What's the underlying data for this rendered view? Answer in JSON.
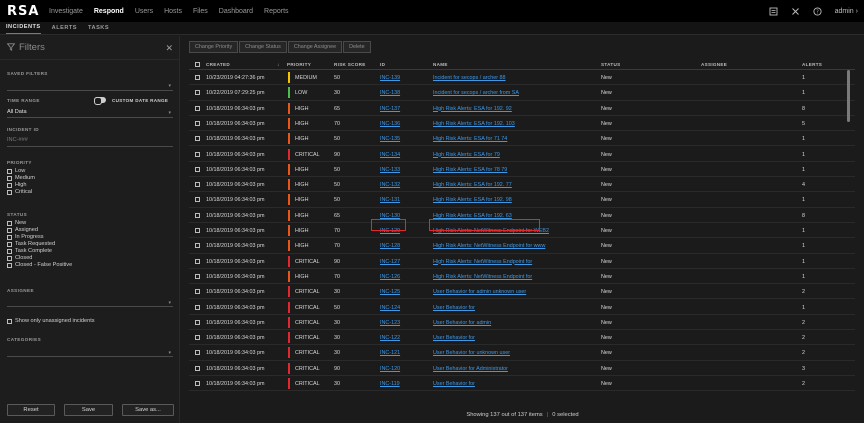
{
  "app": {
    "logo": "RSA",
    "nav": [
      "Investigate",
      "Respond",
      "Users",
      "Hosts",
      "Files",
      "Dashboard",
      "Reports"
    ],
    "active_nav": "Respond",
    "user": "admin",
    "icons": [
      "notes-icon",
      "tools-icon",
      "help-icon"
    ]
  },
  "subnav": {
    "tabs": [
      "INCIDENTS",
      "ALERTS",
      "TASKS"
    ],
    "active": "INCIDENTS"
  },
  "filters": {
    "title": "Filters",
    "saved_filters_label": "SAVED FILTERS",
    "time_range_label": "TIME RANGE",
    "custom_date_range_label": "CUSTOM DATE RANGE",
    "time_range_value": "All Data",
    "incident_id_label": "INCIDENT ID",
    "incident_id_placeholder": "INC-###",
    "priority_label": "PRIORITY",
    "priority_options": [
      "Low",
      "Medium",
      "High",
      "Critical"
    ],
    "status_label": "STATUS",
    "status_options": [
      "New",
      "Assigned",
      "In Progress",
      "Task Requested",
      "Task Complete",
      "Closed",
      "Closed - False Positive"
    ],
    "assignee_label": "ASSIGNEE",
    "unassigned_label": "Show only unassigned incidents",
    "categories_label": "CATEGORIES",
    "buttons": {
      "reset": "Reset",
      "save": "Save",
      "save_as": "Save as..."
    }
  },
  "toolbar": {
    "buttons": [
      "Change Priority",
      "Change Status",
      "Change Assignee",
      "Delete"
    ]
  },
  "table": {
    "headers": {
      "created": "CREATED",
      "priority": "PRIORITY",
      "risk_score": "RISK SCORE",
      "id": "ID",
      "name": "NAME",
      "status": "STATUS",
      "assignee": "ASSIGNEE",
      "alerts": "ALERTS"
    },
    "rows": [
      {
        "created": "10/23/2019 04:27:36 pm",
        "priority": "MEDIUM",
        "risk": "50",
        "id": "INC-139",
        "name": "Incident for secops / archer 88",
        "status": "New",
        "alerts": "1"
      },
      {
        "created": "10/22/2019 07:29:25 pm",
        "priority": "LOW",
        "risk": "30",
        "id": "INC-138",
        "name": "Incident for secops / archer from SA",
        "status": "New",
        "alerts": "1"
      },
      {
        "created": "10/18/2019 06:34:03 pm",
        "priority": "HIGH",
        "risk": "65",
        "id": "INC-137",
        "name": "High Risk Alerts: ESA for 192. 92",
        "status": "New",
        "alerts": "8"
      },
      {
        "created": "10/18/2019 06:34:03 pm",
        "priority": "HIGH",
        "risk": "70",
        "id": "INC-136",
        "name": "High Risk Alerts: ESA for 192. 103",
        "status": "New",
        "alerts": "5"
      },
      {
        "created": "10/18/2019 06:34:03 pm",
        "priority": "HIGH",
        "risk": "50",
        "id": "INC-135",
        "name": "High Risk Alerts: ESA for 71 74",
        "status": "New",
        "alerts": "1"
      },
      {
        "created": "10/18/2019 06:34:03 pm",
        "priority": "CRITICAL",
        "risk": "90",
        "id": "INC-134",
        "name": "High Risk Alerts: ESA for 79",
        "status": "New",
        "alerts": "1"
      },
      {
        "created": "10/18/2019 06:34:03 pm",
        "priority": "HIGH",
        "risk": "50",
        "id": "INC-133",
        "name": "High Risk Alerts: ESA for 78 79",
        "status": "New",
        "alerts": "1"
      },
      {
        "created": "10/18/2019 06:34:03 pm",
        "priority": "HIGH",
        "risk": "50",
        "id": "INC-132",
        "name": "High Risk Alerts: ESA for 192. 77",
        "status": "New",
        "alerts": "4"
      },
      {
        "created": "10/18/2019 06:34:03 pm",
        "priority": "HIGH",
        "risk": "50",
        "id": "INC-131",
        "name": "High Risk Alerts: ESA for 192. 98",
        "status": "New",
        "alerts": "1"
      },
      {
        "created": "10/18/2019 06:34:03 pm",
        "priority": "HIGH",
        "risk": "65",
        "id": "INC-130",
        "name": "High Risk Alerts: ESA for 192. 63",
        "status": "New",
        "alerts": "8"
      },
      {
        "created": "10/18/2019 06:34:03 pm",
        "priority": "HIGH",
        "risk": "70",
        "id": "INC-129",
        "name": "High Risk Alerts: NetWitness Endpoint for WEB2",
        "status": "New",
        "alerts": "1"
      },
      {
        "created": "10/18/2019 06:34:03 pm",
        "priority": "HIGH",
        "risk": "70",
        "id": "INC-128",
        "name": "High Risk Alerts: NetWitness Endpoint for www",
        "status": "New",
        "alerts": "1"
      },
      {
        "created": "10/18/2019 06:34:03 pm",
        "priority": "CRITICAL",
        "risk": "90",
        "id": "INC-127",
        "name": "High Risk Alerts: NetWitness Endpoint for",
        "status": "New",
        "alerts": "1"
      },
      {
        "created": "10/18/2019 06:34:03 pm",
        "priority": "HIGH",
        "risk": "70",
        "id": "INC-126",
        "name": "High Risk Alerts: NetWitness Endpoint for",
        "status": "New",
        "alerts": "1"
      },
      {
        "created": "10/18/2019 06:34:03 pm",
        "priority": "CRITICAL",
        "risk": "30",
        "id": "INC-125",
        "name": "User Behavior for admin unknown user",
        "status": "New",
        "alerts": "2"
      },
      {
        "created": "10/18/2019 06:34:03 pm",
        "priority": "CRITICAL",
        "risk": "50",
        "id": "INC-124",
        "name": "User Behavior for",
        "status": "New",
        "alerts": "1"
      },
      {
        "created": "10/18/2019 06:34:03 pm",
        "priority": "CRITICAL",
        "risk": "30",
        "id": "INC-123",
        "name": "User Behavior for admin",
        "status": "New",
        "alerts": "2"
      },
      {
        "created": "10/18/2019 06:34:03 pm",
        "priority": "CRITICAL",
        "risk": "30",
        "id": "INC-122",
        "name": "User Behavior for",
        "status": "New",
        "alerts": "2"
      },
      {
        "created": "10/18/2019 06:34:03 pm",
        "priority": "CRITICAL",
        "risk": "30",
        "id": "INC-121",
        "name": "User Behavior for unknown user",
        "status": "New",
        "alerts": "2"
      },
      {
        "created": "10/18/2019 06:34:03 pm",
        "priority": "CRITICAL",
        "risk": "90",
        "id": "INC-120",
        "name": "User Behavior for Administrator",
        "status": "New",
        "alerts": "3"
      },
      {
        "created": "10/18/2019 06:34:03 pm",
        "priority": "CRITICAL",
        "risk": "30",
        "id": "INC-119",
        "name": "User Behavior for",
        "status": "New",
        "alerts": "2"
      }
    ],
    "highlighted_id": "INC-130"
  },
  "priority_colors": {
    "MEDIUM": "#f2c500",
    "LOW": "#4bbf4b",
    "HIGH": "#e8561c",
    "CRITICAL": "#e0282e"
  },
  "footer": {
    "showing": "Showing 137 out of 137 items",
    "selected": "0 selected"
  }
}
